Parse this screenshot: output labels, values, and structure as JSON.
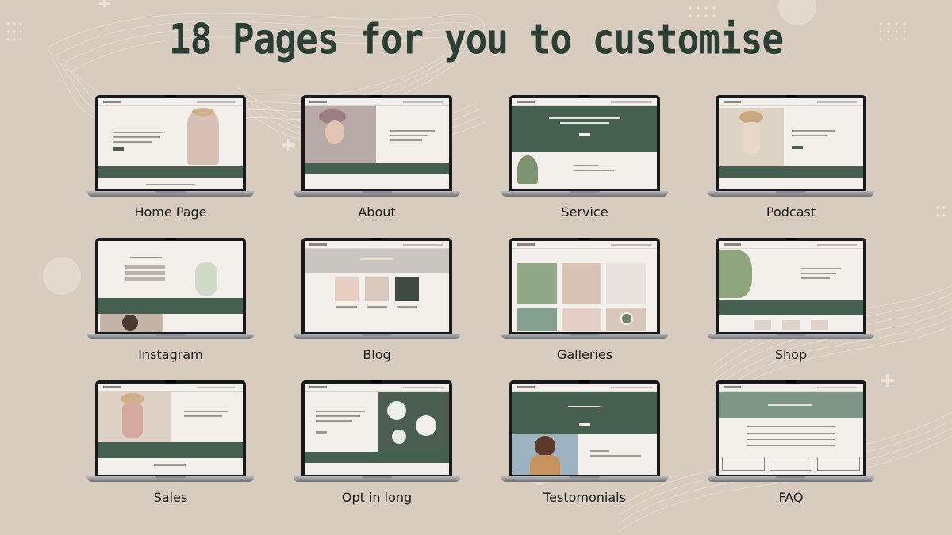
{
  "heading": "18 Pages for you to customise",
  "colors": {
    "background": "#d8cbc0",
    "heading": "#2b3f37",
    "accent_green": "#45604f",
    "screen_cream": "#f3efea"
  },
  "pages": [
    {
      "label": "Home Page"
    },
    {
      "label": "About"
    },
    {
      "label": "Service"
    },
    {
      "label": "Podcast"
    },
    {
      "label": "Instagram"
    },
    {
      "label": "Blog"
    },
    {
      "label": "Galleries"
    },
    {
      "label": "Shop"
    },
    {
      "label": "Sales"
    },
    {
      "label": "Opt in long"
    },
    {
      "label": "Testomonials"
    },
    {
      "label": "FAQ"
    }
  ]
}
